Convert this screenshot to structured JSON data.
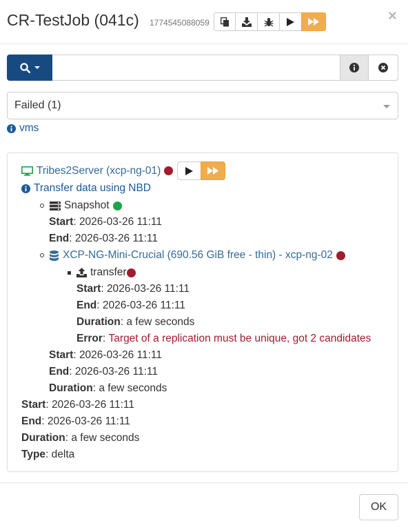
{
  "header": {
    "title": "CR-TestJob (041c)",
    "job_id": "1774545088059",
    "toolbar_icons": [
      "copy-icon",
      "download-icon",
      "bug-icon",
      "play-icon",
      "fast-forward-icon"
    ],
    "close_label": "×"
  },
  "search": {
    "value": "",
    "placeholder": ""
  },
  "filter": {
    "selected": "Failed (1)",
    "link_label": "vms"
  },
  "vm": {
    "name": "Tribes2Server (xcp-ng-01)",
    "status_color": "#a11c2e",
    "transfer_label": "Transfer data using NBD",
    "snapshot": {
      "label": "Snapshot",
      "status_color": "#1ea24a",
      "start_label": "Start",
      "start": ": 2026-03-26 11:11",
      "end_label": "End",
      "end": ": 2026-03-26 11:11"
    },
    "sr": {
      "name": "XCP-NG-Mini-Crucial (690.56 GiB free - thin) - xcp-ng-02",
      "status_color": "#a11c2e",
      "transfer": {
        "label": "transfer",
        "start_label": "Start",
        "start": ": 2026-03-26 11:11",
        "end_label": "End",
        "end": ": 2026-03-26 11:11",
        "duration_label": "Duration",
        "duration": ": a few seconds",
        "error_label": "Error",
        "error_text": "Target of a replication must be unique, got 2 candidates"
      },
      "start_label": "Start",
      "start": ": 2026-03-26 11:11",
      "end_label": "End",
      "end": ": 2026-03-26 11:11",
      "duration_label": "Duration",
      "duration": ": a few seconds"
    },
    "start_label": "Start",
    "start": ": 2026-03-26 11:11",
    "end_label": "End",
    "end": ": 2026-03-26 11:11",
    "duration_label": "Duration",
    "duration": ": a few seconds",
    "type_label": "Type",
    "type": ": delta"
  },
  "footer": {
    "ok_label": "OK"
  },
  "colors": {
    "primary": "#174a80",
    "warning": "#f0ad4e",
    "danger": "#a11c2e",
    "success": "#1ea24a",
    "link": "#336b99"
  }
}
